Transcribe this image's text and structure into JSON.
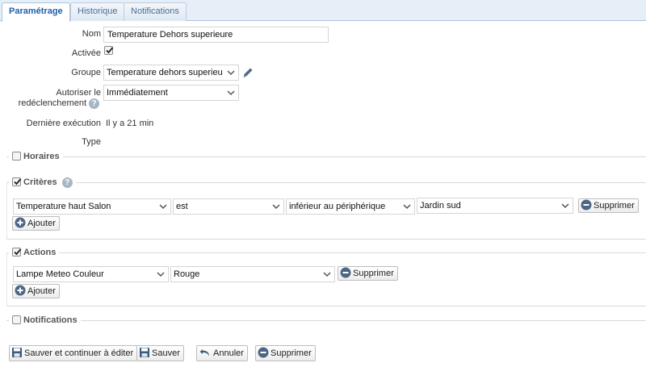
{
  "tabs": [
    {
      "label": "Paramétrage",
      "active": true
    },
    {
      "label": "Historique",
      "active": false
    },
    {
      "label": "Notifications",
      "active": false
    }
  ],
  "form": {
    "nom_label": "Nom",
    "nom_value": "Temperature Dehors superieure",
    "activee_label": "Activée",
    "activee_checked": true,
    "groupe_label": "Groupe",
    "groupe_value": "Temperature dehors superieu",
    "redecl_label_1": "Autoriser le",
    "redecl_label_2": "redéclenchement",
    "redecl_value": "Immédiatement",
    "derniere_label": "Dernière exécution",
    "derniere_value": "Il y a 21 min",
    "type_label": "Type",
    "type_value": ""
  },
  "sections": {
    "horaires": {
      "label": "Horaires",
      "checked": false
    },
    "criteres": {
      "label": "Critères",
      "checked": true
    },
    "actions": {
      "label": "Actions",
      "checked": true
    },
    "notifications": {
      "label": "Notifications",
      "checked": false
    }
  },
  "criteria_row": {
    "field1": "Temperature haut Salon",
    "field2": "est",
    "field3": "inférieur au périphérique",
    "field4": "Jardin sud",
    "delete_label": "Supprimer"
  },
  "criteria_add_label": "Ajouter",
  "action_row": {
    "field1": "Lampe Meteo Couleur",
    "field2": "Rouge",
    "delete_label": "Supprimer"
  },
  "action_add_label": "Ajouter",
  "footer": {
    "save_continue": "Sauver et continuer à éditer",
    "save": "Sauver",
    "cancel": "Annuler",
    "delete": "Supprimer"
  },
  "colors": {
    "accent": "#1f5fa8",
    "tabbar": "#e6eef7"
  },
  "icons": [
    "pencil-icon",
    "help-icon",
    "chevron-down-icon",
    "plus-circle-icon",
    "minus-circle-icon",
    "floppy-icon",
    "undo-icon",
    "checkbox-icon"
  ]
}
